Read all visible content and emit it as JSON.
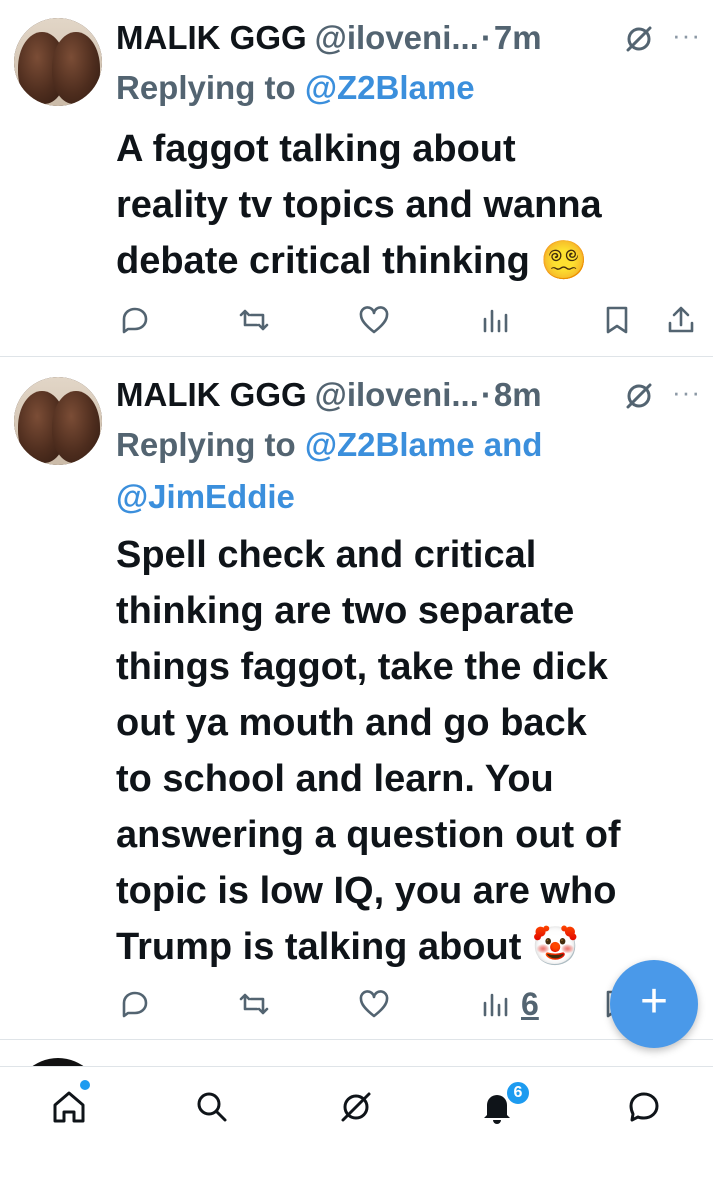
{
  "tweets": [
    {
      "name": "MALIK GGG",
      "handle": "@iloveni...",
      "time": "7m",
      "replying_prefix": "Replying to ",
      "replying_line1": "@Z2Blame",
      "replying_line2": "",
      "body_lines": [
        "A faggot talking about",
        "reality tv topics and wanna",
        "debate critical thinking 😵‍💫"
      ],
      "views": ""
    },
    {
      "name": "MALIK GGG",
      "handle": "@iloveni...",
      "time": "8m",
      "replying_prefix": "Replying to ",
      "replying_line1": "@Z2Blame and",
      "replying_line2": "@JimEddie",
      "body_lines": [
        "Spell check and critical",
        "thinking are two separate",
        "things faggot, take the dick",
        "out ya mouth and go back",
        "to school and learn. You",
        "answering a question out of",
        "topic is low IQ, you are who",
        "Trump is talking about 🤡"
      ],
      "views": "6"
    }
  ],
  "peek": {
    "text": ""
  },
  "fab": {
    "label": "+"
  },
  "nav": {
    "items": [
      "home-icon",
      "search-icon",
      "grok-icon",
      "notifications-icon",
      "messages-icon"
    ],
    "notifications_badge": "6"
  },
  "colors": {
    "accent": "#1d9bf0",
    "mention": "#3b8fdc",
    "muted": "#536471",
    "fab": "#4a99e9"
  }
}
